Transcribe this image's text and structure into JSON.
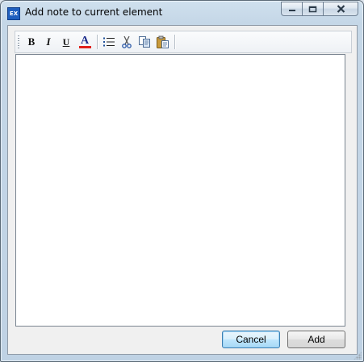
{
  "window": {
    "title": "Add note to current element",
    "app_icon_text": "EX",
    "controls": {
      "minimize": "minimize-icon",
      "maximize": "maximize-icon",
      "close": "close-icon"
    }
  },
  "toolbar": {
    "bold_label": "B",
    "italic_label": "I",
    "underline_label": "U",
    "font_color_label": "A",
    "font_color": "#e0201a",
    "icons": [
      "bold-icon",
      "italic-icon",
      "underline-icon",
      "font-color-icon",
      "bullet-list-icon",
      "cut-icon",
      "copy-icon",
      "paste-icon"
    ]
  },
  "editor": {
    "value": ""
  },
  "buttons": {
    "cancel_label": "Cancel",
    "add_label": "Add"
  },
  "colors": {
    "frame": "#c5d7e7",
    "client": "#f0f0f0",
    "default_button_border": "#3c7fb1"
  }
}
